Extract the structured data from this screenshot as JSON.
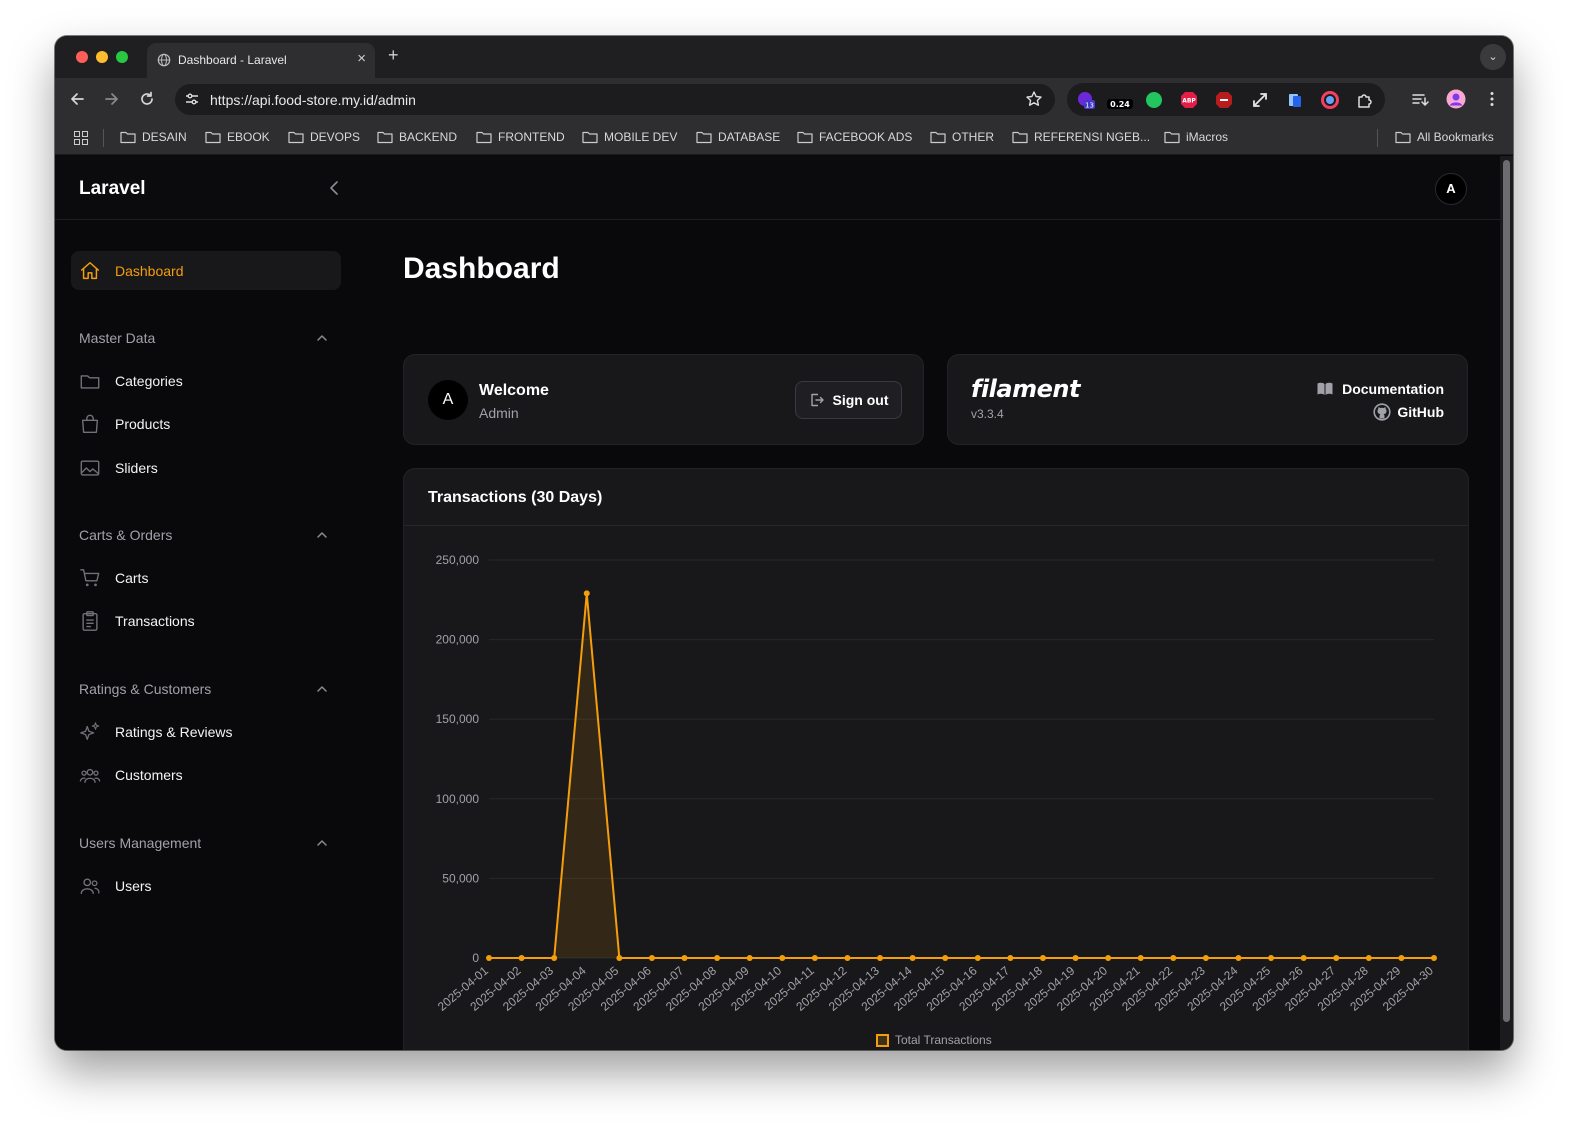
{
  "browser": {
    "tab_title": "Dashboard - Laravel",
    "new_tab_label": "+",
    "url": "https://api.food-store.my.id/admin",
    "extension_badges": {
      "ext1": "13",
      "ext2": "0.24",
      "abp": "ABP"
    },
    "bookmarks": [
      "DESAIN",
      "EBOOK",
      "DEVOPS",
      "BACKEND",
      "FRONTEND",
      "MOBILE DEV",
      "DATABASE",
      "FACEBOOK ADS",
      "OTHER",
      "REFERENSI NGEB...",
      "iMacros"
    ],
    "all_bookmarks": "All Bookmarks"
  },
  "app": {
    "brand": "Laravel",
    "user_initial": "A"
  },
  "sidebar": {
    "dashboard": "Dashboard",
    "groups": [
      {
        "label": "Master Data",
        "items": [
          "Categories",
          "Products",
          "Sliders"
        ]
      },
      {
        "label": "Carts & Orders",
        "items": [
          "Carts",
          "Transactions"
        ]
      },
      {
        "label": "Ratings & Customers",
        "items": [
          "Ratings & Reviews",
          "Customers"
        ]
      },
      {
        "label": "Users Management",
        "items": [
          "Users"
        ]
      }
    ]
  },
  "page": {
    "title": "Dashboard"
  },
  "welcome": {
    "initial": "A",
    "title": "Welcome",
    "role": "Admin",
    "signout": "Sign out"
  },
  "filament": {
    "logo": "filament",
    "version": "v3.3.4",
    "documentation": "Documentation",
    "github": "GitHub"
  },
  "chart_data": {
    "type": "line",
    "title": "Transactions (30 Days)",
    "x": [
      "2025-04-01",
      "2025-04-02",
      "2025-04-03",
      "2025-04-04",
      "2025-04-05",
      "2025-04-06",
      "2025-04-07",
      "2025-04-08",
      "2025-04-09",
      "2025-04-10",
      "2025-04-11",
      "2025-04-12",
      "2025-04-13",
      "2025-04-14",
      "2025-04-15",
      "2025-04-16",
      "2025-04-17",
      "2025-04-18",
      "2025-04-19",
      "2025-04-20",
      "2025-04-21",
      "2025-04-22",
      "2025-04-23",
      "2025-04-24",
      "2025-04-25",
      "2025-04-26",
      "2025-04-27",
      "2025-04-28",
      "2025-04-29",
      "2025-04-30"
    ],
    "series": [
      {
        "name": "Total Transactions",
        "values": [
          0,
          0,
          0,
          229000,
          0,
          0,
          0,
          0,
          0,
          0,
          0,
          0,
          0,
          0,
          0,
          0,
          0,
          0,
          0,
          0,
          0,
          0,
          0,
          0,
          0,
          0,
          0,
          0,
          0,
          0
        ]
      }
    ],
    "ylim": [
      0,
      250000
    ],
    "yticks": [
      "0",
      "50,000",
      "100,000",
      "150,000",
      "200,000",
      "250,000"
    ],
    "grid": true,
    "area_fill": true,
    "legend": "bottom-center",
    "color": "#f59e0b"
  }
}
